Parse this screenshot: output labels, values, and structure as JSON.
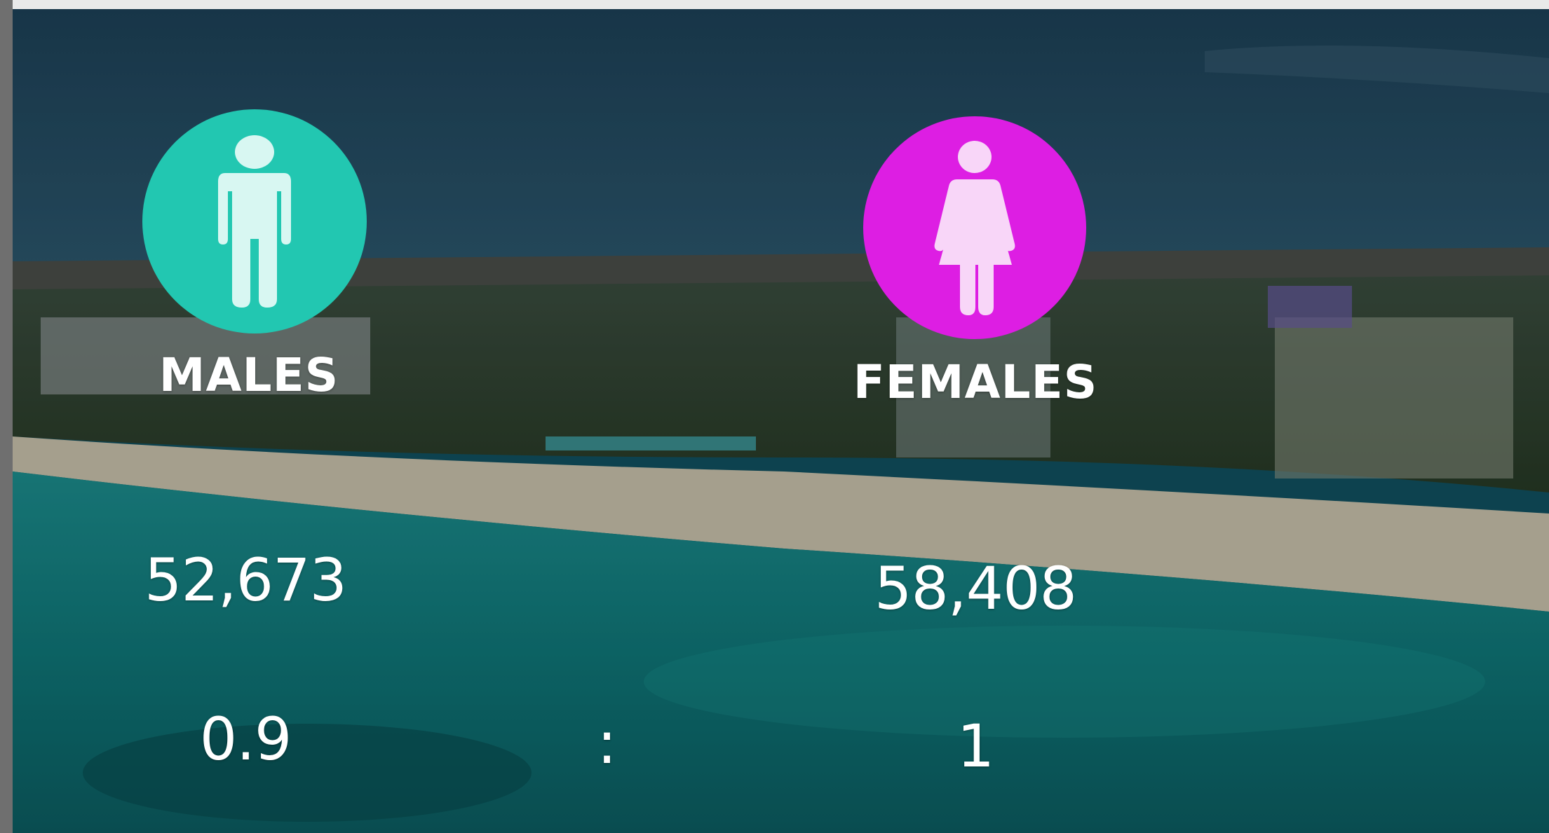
{
  "males": {
    "label": "MALES",
    "count": "52,673",
    "ratio": "0.9",
    "icon": "male-icon",
    "color": "#22c7b1"
  },
  "females": {
    "label": "FEMALES",
    "count": "58,408",
    "ratio": "1",
    "icon": "female-icon",
    "color": "#dd1ee3"
  },
  "ratio_separator": ":"
}
